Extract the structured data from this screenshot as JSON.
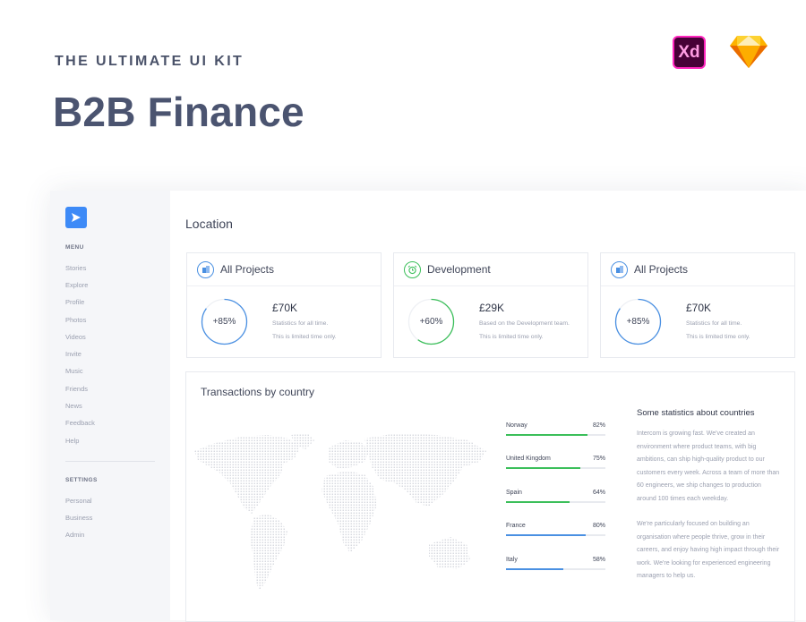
{
  "hero": {
    "kicker": "THE ULTIMATE UI KIT",
    "headline": "B2B Finance",
    "badges": {
      "xd": "Xd",
      "sketch_icon": "sketch-diamond-icon"
    }
  },
  "sidebar": {
    "menu_heading": "MENU",
    "menu_items": [
      "Stories",
      "Explore",
      "Profile",
      "Photos",
      "Videos",
      "Invite",
      "Music",
      "Friends",
      "News",
      "Feedback",
      "Help"
    ],
    "settings_heading": "SETTINGS",
    "settings_items": [
      "Personal",
      "Business",
      "Admin"
    ]
  },
  "main": {
    "title": "Location",
    "cards": [
      {
        "title": "All Projects",
        "icon": "building-icon",
        "percent_label": "+85%",
        "percent": 85,
        "color": "#4a90e2",
        "value": "£70K",
        "desc1": "Statistics for all time.",
        "desc2": "This is limited time only."
      },
      {
        "title": "Development",
        "icon": "alarm-clock-icon",
        "percent_label": "+60%",
        "percent": 60,
        "color": "#3bbf5a",
        "value": "£29K",
        "desc1": "Based on the Development team.",
        "desc2": "This is limited time only."
      },
      {
        "title": "All Projects",
        "icon": "building-icon",
        "percent_label": "+85%",
        "percent": 85,
        "color": "#4a90e2",
        "value": "£70K",
        "desc1": "Statistics for all time.",
        "desc2": "This is limited time only."
      }
    ],
    "transactions": {
      "title": "Transactions by country",
      "countries": [
        {
          "name": "Norway",
          "label": "82%",
          "percent": 82,
          "color": "#3bbf5a"
        },
        {
          "name": "United Kingdom",
          "label": "75%",
          "percent": 75,
          "color": "#3bbf5a"
        },
        {
          "name": "Spain",
          "label": "64%",
          "percent": 64,
          "color": "#3bbf5a"
        },
        {
          "name": "France",
          "label": "80%",
          "percent": 80,
          "color": "#4a90e2"
        },
        {
          "name": "Italy",
          "label": "58%",
          "percent": 58,
          "color": "#4a90e2"
        }
      ],
      "stats_title": "Some statistics about countries",
      "para1": "Intercom is growing fast. We've created an environment where product teams, with big ambitions, can ship high-quality product to our customers every week. Across a team of more than 60 engineers, we ship changes to production around 100 times each weekday.",
      "para2": "We're particularly focused on building an organisation where people thrive, grow in their careers, and enjoy having high impact through their work. We're looking for experienced engineering managers to help us."
    }
  }
}
